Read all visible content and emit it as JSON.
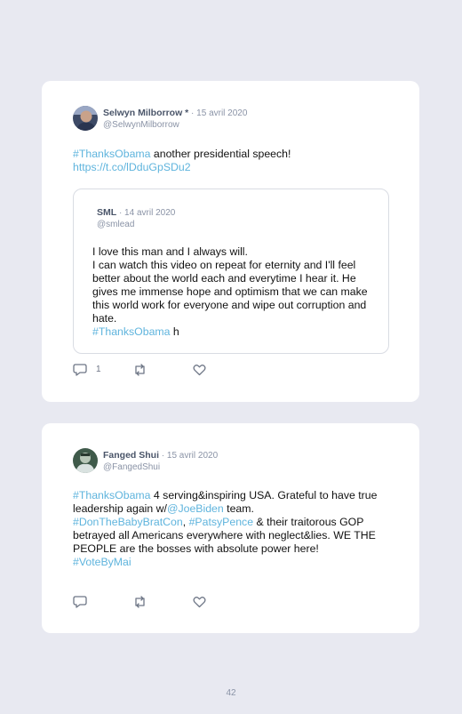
{
  "tweets": [
    {
      "name": "Selwyn Milborrow",
      "name_suffix": " *",
      "date": " · 15 avril 2020",
      "handle": "@SelwynMilborrow",
      "text_segments": [
        {
          "t": "#ThanksObama",
          "link": true
        },
        {
          "t": " another presidential speech!",
          "link": false
        },
        {
          "br": true
        },
        {
          "t": "https://t.co/lDduGpSDu2",
          "link": true
        }
      ],
      "quote": {
        "name": "SML",
        "date": " · 14 avril 2020",
        "handle": "@smlead",
        "text_segments": [
          {
            "t": "I love this man and I always will.",
            "link": false
          },
          {
            "br": true
          },
          {
            "t": "I can watch this video on repeat for eternity and I'll feel better about the world each and everytime I hear it. He gives me immense hope and optimism that we can make this world work for everyone and wipe out corruption and hate.",
            "link": false
          },
          {
            "br": true
          },
          {
            "t": "#ThanksObama",
            "link": true
          },
          {
            "t": " h",
            "link": false
          }
        ]
      },
      "reply_count": "1"
    },
    {
      "name": "Fanged Shui",
      "name_suffix": "",
      "date": " · 15 avril 2020",
      "handle": "@FangedShui",
      "text_segments": [
        {
          "t": "#ThanksObama",
          "link": true
        },
        {
          "t": " 4 serving&inspiring USA. Grateful to have true leadership again w/",
          "link": false
        },
        {
          "t": "@JoeBiden",
          "link": true
        },
        {
          "t": " team.",
          "link": false
        },
        {
          "br": true
        },
        {
          "t": "#DonTheBabyBratCon",
          "link": true
        },
        {
          "t": ", ",
          "link": false
        },
        {
          "t": "#PatsyPence",
          "link": true
        },
        {
          "t": " & their traitorous GOP betrayed all Americans everywhere with neglect&lies. WE THE PEOPLE are the bosses with absolute power here!",
          "link": false
        },
        {
          "br": true
        },
        {
          "t": "#VoteByMai",
          "link": true
        }
      ],
      "reply_count": ""
    }
  ],
  "page_number": "42",
  "colors": {
    "background": "#e8e9f1",
    "link": "#5fb4dd",
    "meta": "#8a93a6"
  },
  "icons": [
    "reply-icon",
    "retweet-icon",
    "like-icon"
  ]
}
